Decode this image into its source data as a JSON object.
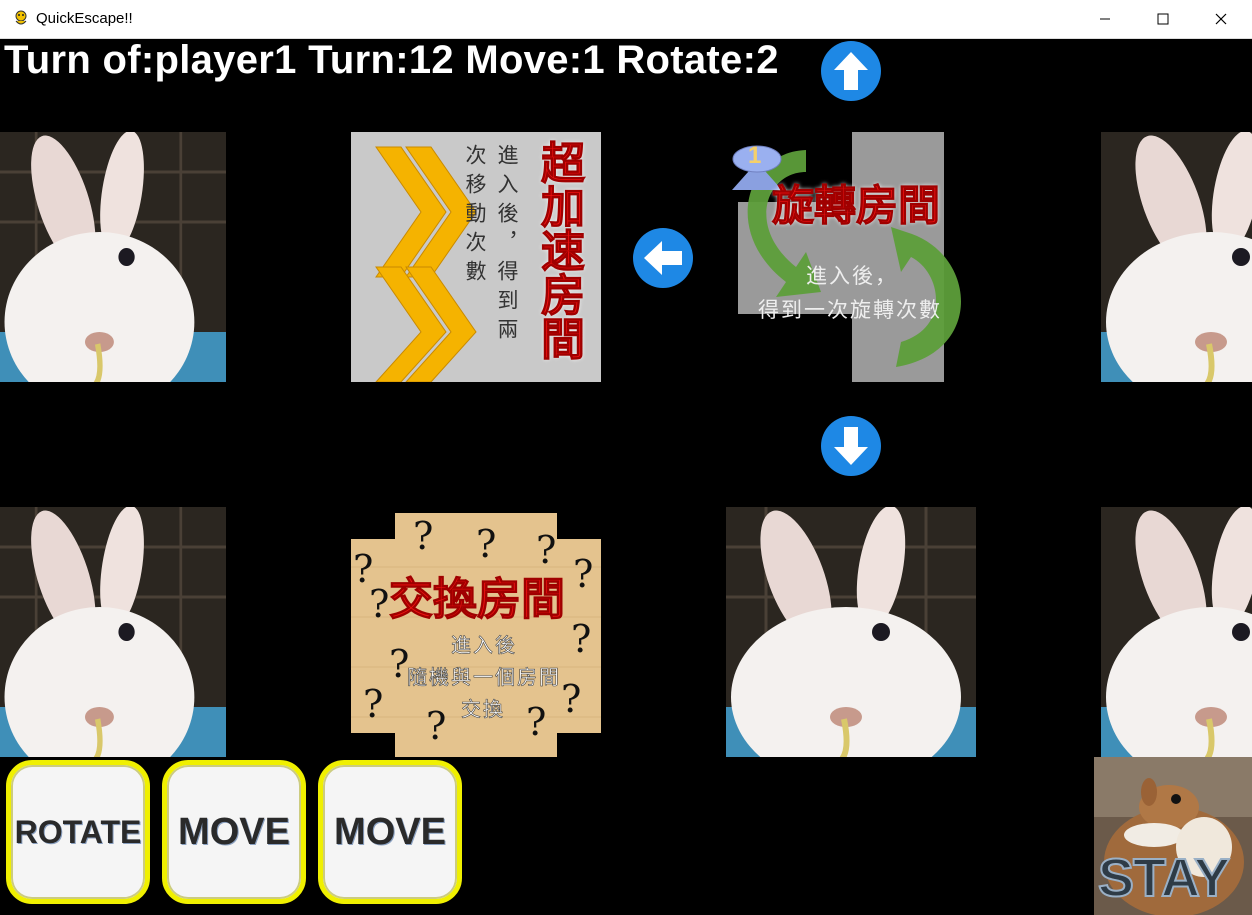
{
  "window": {
    "title": "QuickEscape!!"
  },
  "hud": {
    "text": "Turn of:player1 Turn:12 Move:1 Rotate:2"
  },
  "cards": {
    "speed": {
      "title": "超加速房間",
      "desc": "進入後，得到兩次移動次數"
    },
    "rotate": {
      "badge": "1",
      "title": "旋轉房間",
      "line1": "進入後，",
      "line2": "得到一次旋轉次數"
    },
    "swap": {
      "title": "交換房間",
      "line1": "進入後",
      "line2": "隨機與一個房間",
      "line3": "交換"
    }
  },
  "actions": {
    "rotate": "ROTATE",
    "move1": "MOVE",
    "move2": "MOVE",
    "stay": "STAY"
  },
  "colors": {
    "card_title_red": "#ee1111",
    "button_border": "#f0f000",
    "arrow_blue": "#1e88e5"
  }
}
